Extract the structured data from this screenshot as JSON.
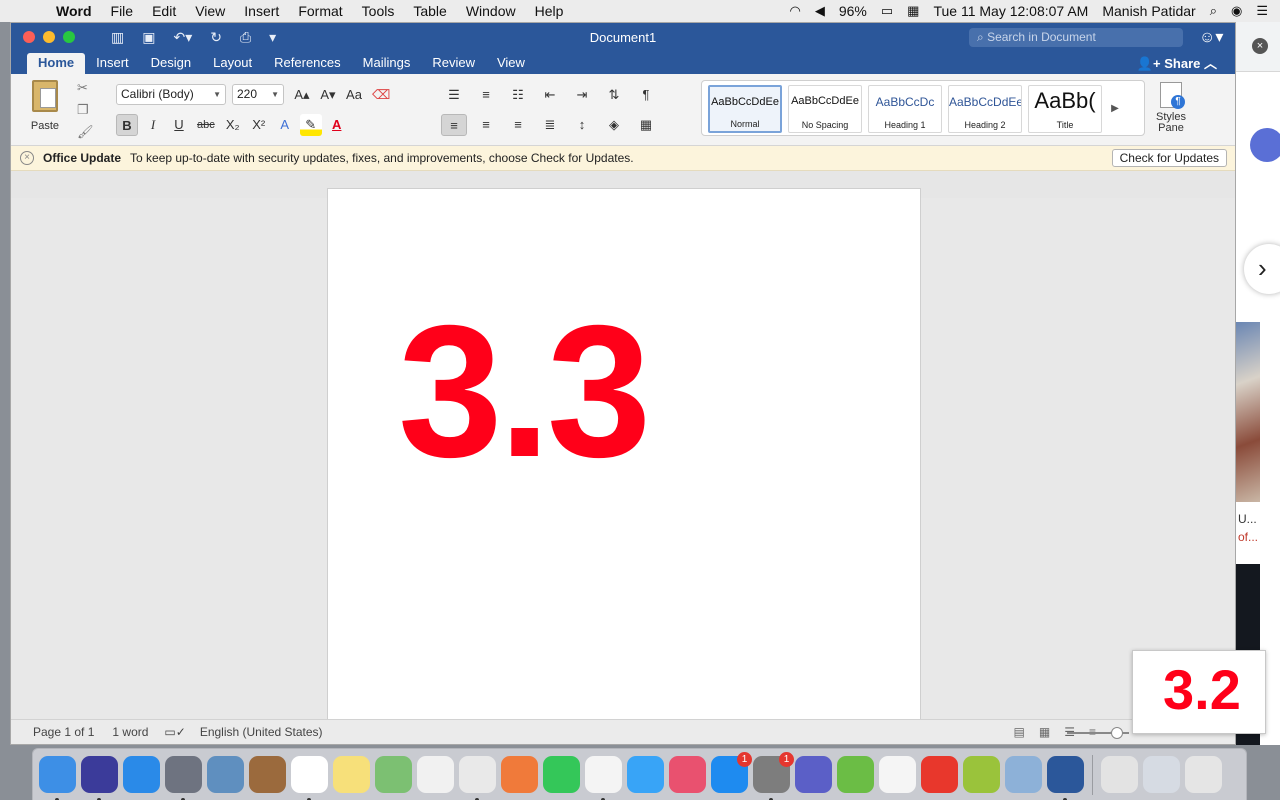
{
  "menubar": {
    "app": "Word",
    "items": [
      "File",
      "Edit",
      "View",
      "Insert",
      "Format",
      "Tools",
      "Table",
      "Window",
      "Help"
    ],
    "battery": "96%",
    "datetime": "Tue 11 May  12:08:07 AM",
    "user": "Manish Patidar"
  },
  "window": {
    "title": "Document1",
    "search_placeholder": "Search in Document",
    "share": "Share",
    "tabs": [
      "Home",
      "Insert",
      "Design",
      "Layout",
      "References",
      "Mailings",
      "Review",
      "View"
    ],
    "active_tab": "Home"
  },
  "ribbon": {
    "paste": "Paste",
    "font": "Calibri (Body)",
    "size": "220",
    "buttons": {
      "grow": "A▴",
      "shrink": "A▾",
      "case": "Aa",
      "bold": "B",
      "italic": "I",
      "underline": "U",
      "strike": "abc",
      "sub": "X₂",
      "sup": "X²",
      "effects": "A",
      "highlight": "✎",
      "fontcolor": "A"
    },
    "styles": [
      {
        "sample": "AaBbCcDdEe",
        "name": "Normal"
      },
      {
        "sample": "AaBbCcDdEe",
        "name": "No Spacing"
      },
      {
        "sample": "AaBbCcDc",
        "name": "Heading 1"
      },
      {
        "sample": "AaBbCcDdEe",
        "name": "Heading 2"
      },
      {
        "sample": "AaBb(",
        "name": "Title"
      }
    ],
    "styles_pane": "Styles\nPane"
  },
  "update_bar": {
    "title": "Office Update",
    "message": "To keep up-to-date with security updates, fixes, and improvements, choose Check for Updates.",
    "button": "Check for Updates"
  },
  "document": {
    "text": "3.3",
    "text_color": "#ff0019"
  },
  "status": {
    "page": "Page 1 of 1",
    "words": "1 word",
    "language": "English (United States)"
  },
  "thumbnail": {
    "text": "3.2"
  },
  "background_app": {
    "text1": "U...",
    "text2": "of..."
  },
  "dock": {
    "icons": [
      {
        "name": "finder",
        "color": "#3d8fe6"
      },
      {
        "name": "siri",
        "color": "#3b3b9a"
      },
      {
        "name": "safari",
        "color": "#2a8ae8"
      },
      {
        "name": "launchpad",
        "color": "#6e7380"
      },
      {
        "name": "mail-preview",
        "color": "#5f8fbf"
      },
      {
        "name": "notebook",
        "color": "#9b6a3d"
      },
      {
        "name": "calendar",
        "color": "#ffffff"
      },
      {
        "name": "notes",
        "color": "#f7e07a"
      },
      {
        "name": "maps",
        "color": "#7cc072"
      },
      {
        "name": "photos",
        "color": "#f1f1f1"
      },
      {
        "name": "chrome",
        "color": "#e9e9e9"
      },
      {
        "name": "sketch",
        "color": "#f07a3a"
      },
      {
        "name": "facetime",
        "color": "#34c759"
      },
      {
        "name": "xcode-app",
        "color": "#f4f4f4"
      },
      {
        "name": "messages",
        "color": "#38a4f7"
      },
      {
        "name": "itunes",
        "color": "#e9516f"
      },
      {
        "name": "app-store",
        "color": "#1e8bf0"
      },
      {
        "name": "system-prefs",
        "color": "#7d7d7d"
      },
      {
        "name": "teams",
        "color": "#5b5fc7"
      },
      {
        "name": "utorrent",
        "color": "#6bbd45"
      },
      {
        "name": "textedit",
        "color": "#f5f5f5"
      },
      {
        "name": "ticktick-app",
        "color": "#e8372c"
      },
      {
        "name": "android-file",
        "color": "#9ac33b"
      },
      {
        "name": "preview",
        "color": "#8db1d8"
      },
      {
        "name": "word",
        "color": "#2b579a"
      },
      {
        "name": "documents-folder",
        "color": "#e3e3e3"
      },
      {
        "name": "downloads-folder",
        "color": "#d6dbe3"
      },
      {
        "name": "trash",
        "color": "#e5e5e5"
      }
    ],
    "badges": {
      "mail-preview": "",
      "app-store": "1",
      "system-prefs": "1"
    }
  }
}
